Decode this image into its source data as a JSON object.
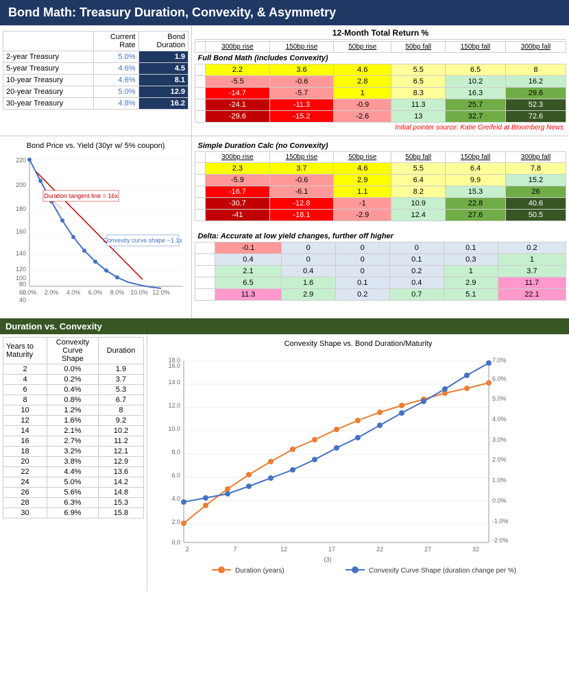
{
  "title": "Bond Math: Treasury Duration, Convexity, & Asymmetry",
  "section_duration_convexity": "Duration vs. Convexity",
  "table": {
    "headers": [
      "",
      "Current Rate",
      "Bond Duration"
    ],
    "rows": [
      {
        "name": "2-year Treasury",
        "rate": "5.0%",
        "duration": "1.9"
      },
      {
        "name": "5-year Treasury",
        "rate": "4.6%",
        "duration": "4.5"
      },
      {
        "name": "10-year Treasury",
        "rate": "4.6%",
        "duration": "8.1"
      },
      {
        "name": "20-year Treasury",
        "rate": "5.0%",
        "duration": "12.9"
      },
      {
        "name": "30-year Treasury",
        "rate": "4.8%",
        "duration": "16.2"
      }
    ]
  },
  "return_table": {
    "main_title": "12-Month Total Return %",
    "col_headers": [
      "300bp rise",
      "150bp rise",
      "50bp rise",
      "50bp fall",
      "150bp fall",
      "300bp fall"
    ],
    "full_bond_label": "Full Bond Math (includes Convexity)",
    "full_bond_rows": [
      [
        2.2,
        3.6,
        4.6,
        5.5,
        6.5,
        8.0
      ],
      [
        -5.5,
        -0.6,
        2.8,
        6.5,
        10.2,
        16.2
      ],
      [
        -14.7,
        -5.7,
        1.0,
        8.3,
        16.3,
        29.6
      ],
      [
        -24.1,
        -11.3,
        -0.9,
        11.3,
        25.7,
        52.3
      ],
      [
        -29.6,
        -15.2,
        -2.6,
        13.0,
        32.7,
        72.6
      ]
    ],
    "simple_label": "Simple Duration Calc (no Convexity)",
    "simple_rows": [
      [
        2.3,
        3.7,
        4.6,
        5.5,
        6.4,
        7.8
      ],
      [
        -5.9,
        -0.6,
        2.9,
        6.4,
        9.9,
        15.2
      ],
      [
        -16.7,
        -6.1,
        1.1,
        8.2,
        15.3,
        26.0
      ],
      [
        -30.7,
        -12.8,
        -1.0,
        10.9,
        22.8,
        40.6
      ],
      [
        -41.0,
        -18.1,
        -2.9,
        12.4,
        27.6,
        50.5
      ]
    ],
    "delta_label": "Delta: Accurate at low yield changes, further off higher",
    "delta_rows": [
      [
        -0.1,
        0.0,
        0.0,
        0.0,
        0.1,
        0.2
      ],
      [
        0.4,
        0.0,
        0.0,
        0.1,
        0.3,
        1.0
      ],
      [
        2.1,
        0.4,
        0.0,
        0.2,
        1.0,
        3.7
      ],
      [
        6.5,
        1.6,
        0.1,
        0.4,
        2.9,
        11.7
      ],
      [
        11.3,
        2.9,
        0.2,
        0.7,
        5.1,
        22.1
      ]
    ],
    "source": "Initial pointer source: Katie Greifeld at Bloomberg News"
  },
  "chart1_title": "Bond Price vs. Yield (30yr w/ 5% coupon)",
  "chart1_annotation1": "Duration tangent line = 16x",
  "chart1_annotation2": "Convexity curve shape ~1.1x",
  "convexity_table": {
    "headers": [
      "Years to Maturity",
      "Convexity Curve Shape",
      "Duration"
    ],
    "rows": [
      [
        2,
        "0.0%",
        1.9
      ],
      [
        4,
        "0.2%",
        3.7
      ],
      [
        6,
        "0.4%",
        5.3
      ],
      [
        8,
        "0.8%",
        6.7
      ],
      [
        10,
        "1.2%",
        8.0
      ],
      [
        12,
        "1.6%",
        9.2
      ],
      [
        14,
        "2.1%",
        10.2
      ],
      [
        16,
        "2.7%",
        11.2
      ],
      [
        18,
        "3.2%",
        12.1
      ],
      [
        20,
        "3.8%",
        12.9
      ],
      [
        22,
        "4.4%",
        13.6
      ],
      [
        24,
        "5.0%",
        14.2
      ],
      [
        26,
        "5.6%",
        14.8
      ],
      [
        28,
        "6.3%",
        15.3
      ],
      [
        30,
        "6.9%",
        15.8
      ]
    ]
  },
  "chart2_title": "Convexity Shape vs. Bond Duration/Maturity",
  "chart2_legend": [
    "Duration (years)",
    "Convexity Curve Shape (duration change per %)"
  ]
}
